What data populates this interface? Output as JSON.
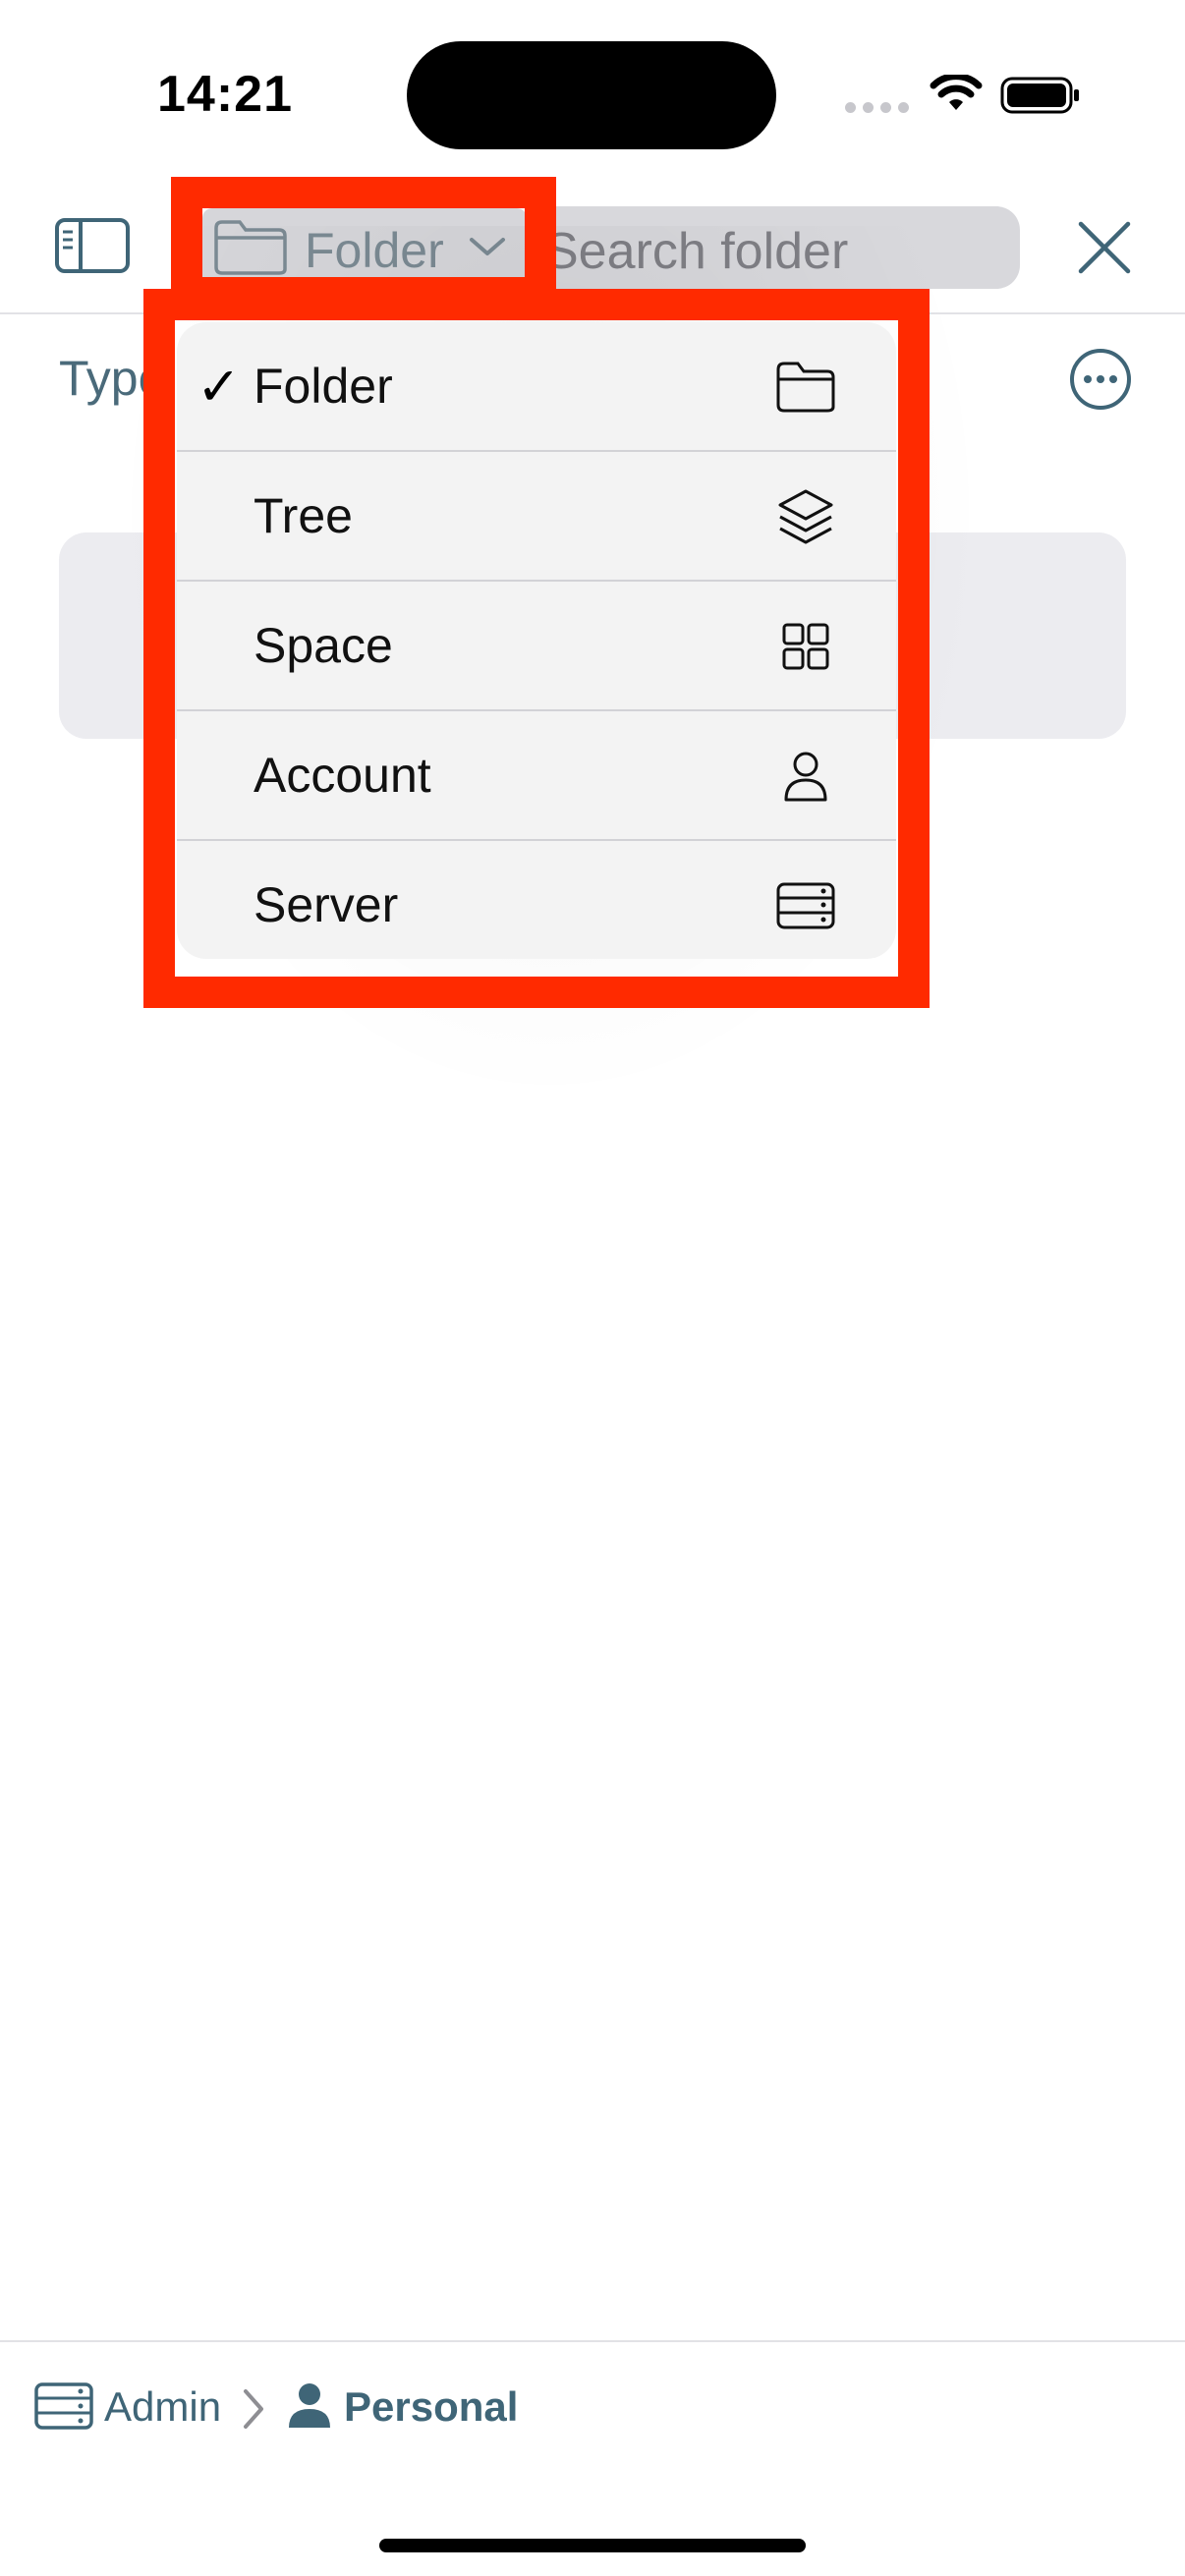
{
  "status_bar": {
    "time": "14:21"
  },
  "toolbar": {
    "scope_label": "Folder",
    "search_placeholder": "Search folder"
  },
  "content": {
    "type_label": "Type"
  },
  "menu": {
    "items": [
      {
        "label": "Folder",
        "checked": "✓",
        "icon": "folder-icon"
      },
      {
        "label": "Tree",
        "checked": "",
        "icon": "layers-icon"
      },
      {
        "label": "Space",
        "checked": "",
        "icon": "grid-icon"
      },
      {
        "label": "Account",
        "checked": "",
        "icon": "person-icon"
      },
      {
        "label": "Server",
        "checked": "",
        "icon": "server-icon"
      }
    ]
  },
  "breadcrumb": {
    "admin": "Admin",
    "personal": "Personal"
  },
  "colors": {
    "accent": "#3f6577",
    "highlight": "#ff2a00",
    "menu_bg": "#f3f3f3"
  }
}
